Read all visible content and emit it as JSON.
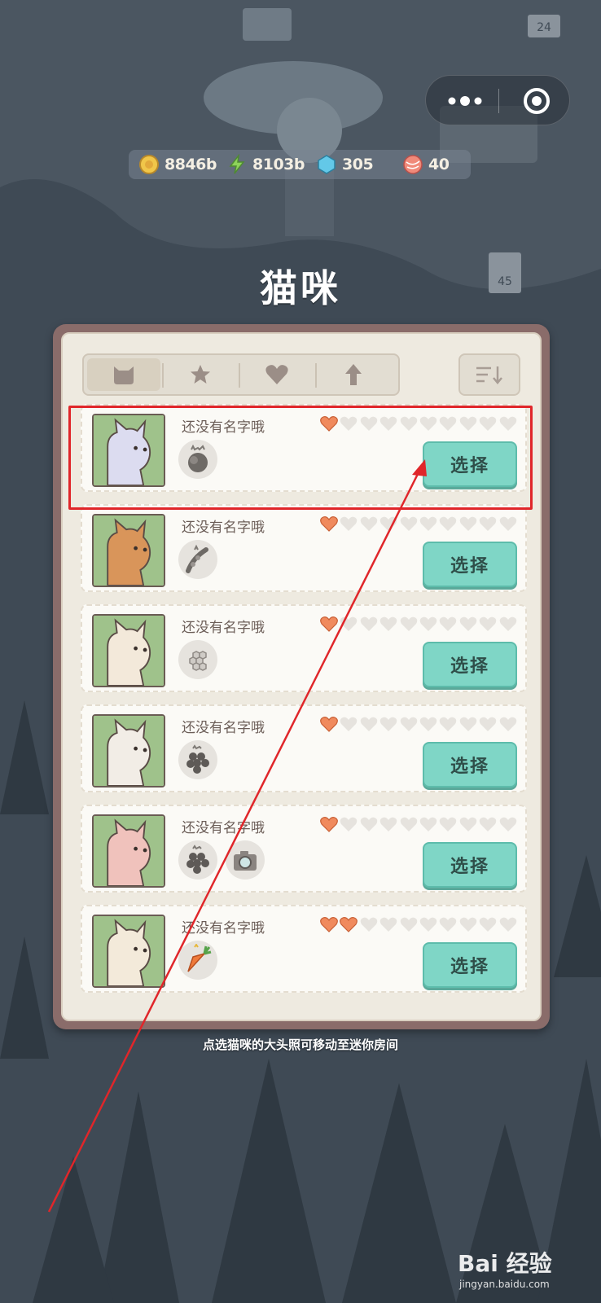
{
  "currencies": [
    {
      "icon": "gold-coin-icon",
      "value": "8846b"
    },
    {
      "icon": "lightning-icon",
      "value": "8103b"
    },
    {
      "icon": "gem-icon",
      "value": "305"
    },
    {
      "icon": "yarn-ball-icon",
      "value": "40"
    }
  ],
  "title": "猫咪",
  "tabs": [
    "cat-icon",
    "star-icon",
    "heart-icon",
    "arrow-up-icon"
  ],
  "sort_icon": "sort-icon",
  "cats": [
    {
      "name": "还没有名字哦",
      "hearts_filled": 1,
      "hearts_total": 10,
      "items": [
        "rock-item-icon"
      ],
      "button": "选择",
      "fur": "#dcdcf0"
    },
    {
      "name": "还没有名字哦",
      "hearts_filled": 1,
      "hearts_total": 10,
      "items": [
        "bean-pod-item-icon"
      ],
      "button": "选择",
      "fur": "#d9955a"
    },
    {
      "name": "还没有名字哦",
      "hearts_filled": 1,
      "hearts_total": 10,
      "items": [
        "honeycomb-item-icon"
      ],
      "button": "选择",
      "fur": "#f3e9da"
    },
    {
      "name": "还没有名字哦",
      "hearts_filled": 1,
      "hearts_total": 10,
      "items": [
        "grapes-item-icon"
      ],
      "button": "选择",
      "fur": "#f2ede6"
    },
    {
      "name": "还没有名字哦",
      "hearts_filled": 1,
      "hearts_total": 10,
      "items": [
        "grapes-item-icon",
        "camera-item-icon"
      ],
      "button": "选择",
      "fur": "#f0c2bc"
    },
    {
      "name": "还没有名字哦",
      "hearts_filled": 2,
      "hearts_total": 10,
      "items": [
        "carrot-item-icon"
      ],
      "button": "选择",
      "fur": "#f3eada"
    }
  ],
  "hint": "点选猫咪的大头照可移动至迷你房间",
  "watermark": {
    "logo": "Bai 经验",
    "url": "jingyan.baidu.com"
  },
  "colors": {
    "accent_button": "#7fd6c6",
    "heart_filled": "#f08a5d",
    "heart_empty": "#e6e3de",
    "highlight": "#e0262a"
  }
}
